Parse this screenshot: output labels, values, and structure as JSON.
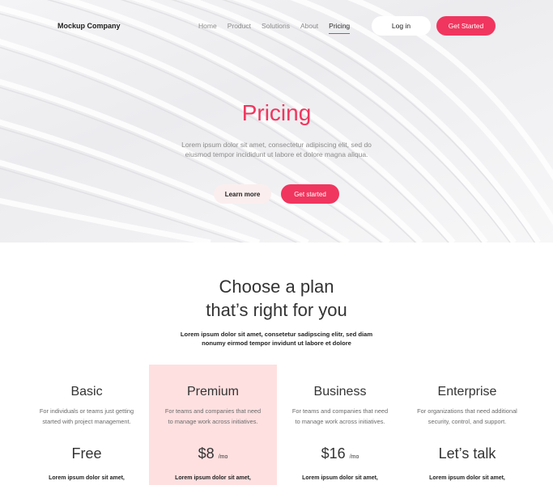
{
  "nav": {
    "logo": "Mockup Company",
    "links": [
      "Home",
      "Product",
      "Solutions",
      "About",
      "Pricing"
    ],
    "active_link": "Pricing",
    "login_label": "Log in",
    "get_started_label": "Get Started"
  },
  "hero": {
    "title": "Pricing",
    "subtitle": "Lorem ipsum dolor sit amet, consectetur adipiscing elit, sed do eiusmod tempor incididunt ut labore et dolore magna aliqua.",
    "learn_more_label": "Learn more",
    "get_started_label": "Get started"
  },
  "plans": {
    "title_line1": "Choose a plan",
    "title_line2": "that’s right for you",
    "subtitle": "Lorem ipsum dolor sit amet, consetetur sadipscing elitr, sed diam nonumy eirmod tempor invidunt ut labore et dolore",
    "columns": [
      {
        "name": "Basic",
        "desc": "For individuals or teams just getting started with project management.",
        "price": "Free",
        "per": "",
        "feature": "Lorem ipsum dolor sit amet,"
      },
      {
        "name": "Premium",
        "desc": "For teams and companies that need to manage work across initiatives.",
        "price": "$8",
        "per": "/mo",
        "feature": "Lorem ipsum dolor sit amet,"
      },
      {
        "name": "Business",
        "desc": "For teams and companies that need to manage work across initiatives.",
        "price": "$16",
        "per": "/mo",
        "feature": "Lorem ipsum dolor sit amet,"
      },
      {
        "name": "Enterprise",
        "desc": "For organizations that need additional security, control, and support.",
        "price": "Let’s talk",
        "per": "",
        "feature": "Lorem ipsum dolor sit amet,"
      }
    ]
  },
  "colors": {
    "accent": "#f0365e",
    "premium_bg": "#ffe0e0",
    "learn_more_bg": "#fbeeee"
  }
}
